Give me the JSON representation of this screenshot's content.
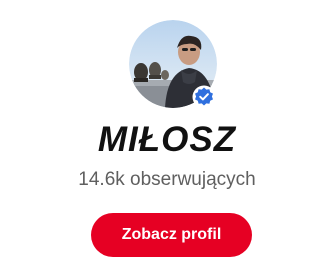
{
  "profile": {
    "name": "MIŁOSZ",
    "followers": "14.6k obserwujących",
    "verified": true
  },
  "actions": {
    "view_profile_label": "Zobacz profil"
  },
  "colors": {
    "accent": "#e60023",
    "verified_badge": "#2f6fde",
    "secondary_text": "#5f5f5f"
  },
  "icons": {
    "verified": "verified-badge-icon"
  }
}
